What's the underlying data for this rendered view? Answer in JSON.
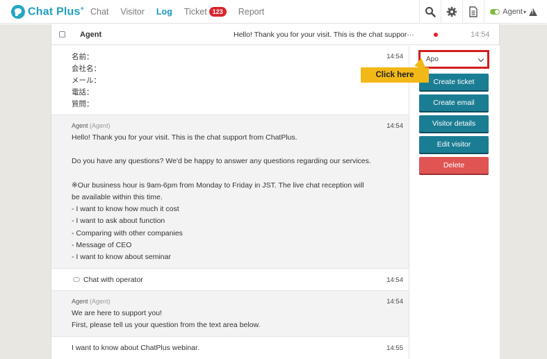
{
  "header": {
    "logo_text": "Chat Plus",
    "logo_sup": "+",
    "nav": [
      {
        "label": "Chat",
        "active": false
      },
      {
        "label": "Visitor",
        "active": false
      },
      {
        "label": "Log",
        "active": true
      },
      {
        "label": "Ticket",
        "active": false,
        "badge": "123"
      },
      {
        "label": "Report",
        "active": false
      }
    ],
    "icons": [
      "search-icon",
      "gear-icon",
      "document-icon"
    ],
    "agent_label": "Agent",
    "agent_status_color": "#7fb843"
  },
  "thread": {
    "name": "Agent",
    "preview": "Hello! Thank you for your visit. This is the chat suppor···",
    "time": "14:54",
    "unread_color": "#e0202a"
  },
  "messages": [
    {
      "time": "14:54",
      "lines": [
        "名前：",
        "会社名：",
        "メール：",
        "電話：",
        "質問："
      ]
    },
    {
      "from": "Agent",
      "role": "(Agent)",
      "time": "14:54",
      "lines": [
        "Hello! Thank you for your visit. This is the chat support from ChatPlus.",
        "",
        "Do you have any questions? We'd be happy to answer any questions regarding our services.",
        "",
        "※Our business hour is 9am-6pm from Monday to Friday in JST. The live chat reception will",
        "be available within this time.",
        "- I want to know how much it cost",
        "- I want to ask about function",
        "- Comparing with other companies",
        "- Message of CEO",
        "- I want to know about seminar"
      ]
    },
    {
      "system": "Chat with operator",
      "time": "14:54"
    },
    {
      "from": "Agent",
      "role": "(Agent)",
      "time": "14:54",
      "lines": [
        "We are here to support you!",
        "First, please tell us your question from the text area below."
      ]
    },
    {
      "time": "14:55",
      "lines": [
        "I want to know about ChatPlus webinar."
      ]
    }
  ],
  "side": {
    "select_value": "Apo",
    "callout": "Click here",
    "buttons": [
      {
        "label": "Create ticket",
        "color": "#1b7d93"
      },
      {
        "label": "Create email",
        "color": "#1b7d93"
      },
      {
        "label": "Visitor details",
        "color": "#1b7d93"
      },
      {
        "label": "Edit visitor",
        "color": "#1b7d93"
      },
      {
        "label": "Delete",
        "color": "#e05454"
      }
    ]
  }
}
